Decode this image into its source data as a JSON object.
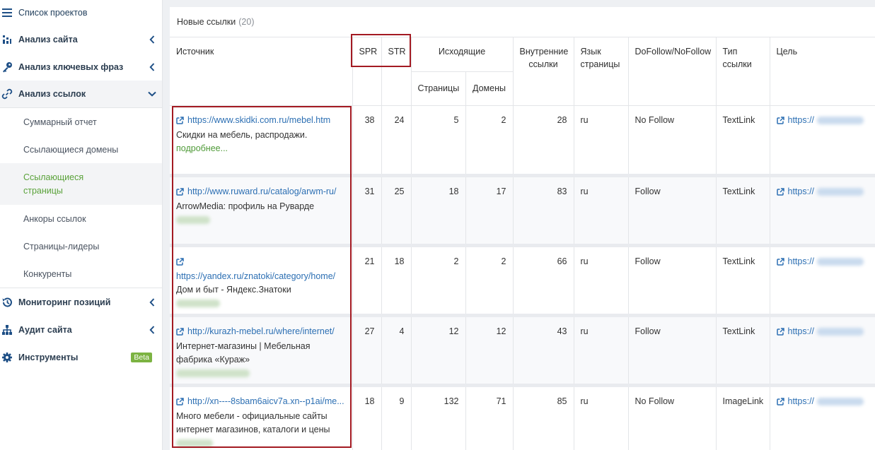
{
  "sidebar": {
    "top": {
      "label": "Список проектов",
      "icon": "menu-icon"
    },
    "items": [
      {
        "label": "Анализ сайта",
        "icon": "site-analysis-icon"
      },
      {
        "label": "Анализ ключевых фраз",
        "icon": "key-icon"
      },
      {
        "label": "Анализ ссылок",
        "icon": "link-icon"
      },
      {
        "label": "Мониторинг позиций",
        "icon": "history-icon"
      },
      {
        "label": "Аудит сайта",
        "icon": "sitemap-icon"
      },
      {
        "label": "Инструменты",
        "icon": "gear-icon",
        "badge": "Beta"
      }
    ],
    "subitems": [
      "Суммарный отчет",
      "Ссылающиеся домены",
      "Ссылающиеся страницы",
      "Анкоры ссылок",
      "Страницы-лидеры",
      "Конкуренты"
    ]
  },
  "panel": {
    "title": "Новые ссылки",
    "count": "(20)"
  },
  "table": {
    "headers": {
      "source": "Источник",
      "spr": "SPR",
      "str": "STR",
      "outgoing": "Исходящие",
      "pages": "Страницы",
      "domains": "Домены",
      "internal": "Внутренние ссылки",
      "lang": "Язык страницы",
      "follow": "DoFollow/NoFollow",
      "type": "Тип ссылки",
      "target": "Цель"
    },
    "rows": [
      {
        "url": "https://www.skidki.com.ru/mebel.htm",
        "title": "Скидки на мебель, распродажи.",
        "more": "подробнее...",
        "spr": "38",
        "str": "24",
        "pages": "5",
        "domains": "2",
        "internal": "28",
        "lang": "ru",
        "follow": "No Follow",
        "type": "TextLink",
        "target": "https://"
      },
      {
        "url": "http://www.ruward.ru/catalog/arwm-ru/",
        "title": "ArrowMedia: профиль на Руварде",
        "spr": "31",
        "str": "25",
        "pages": "18",
        "domains": "17",
        "internal": "83",
        "lang": "ru",
        "follow": "Follow",
        "type": "TextLink",
        "target": "https://"
      },
      {
        "url": "https://yandex.ru/znatoki/category/home/",
        "title": "Дом и быт - Яндекс.Знатоки",
        "spr": "21",
        "str": "18",
        "pages": "2",
        "domains": "2",
        "internal": "66",
        "lang": "ru",
        "follow": "Follow",
        "type": "TextLink",
        "target": "https://"
      },
      {
        "url": "http://kurazh-mebel.ru/where/internet/",
        "title": "Интернет-магазины | Мебельная фабрика «Кураж»",
        "spr": "27",
        "str": "4",
        "pages": "12",
        "domains": "12",
        "internal": "43",
        "lang": "ru",
        "follow": "Follow",
        "type": "TextLink",
        "target": "https://"
      },
      {
        "url": "http://xn----8sbam6aicv7a.xn--p1ai/me...",
        "title": "Много мебели - официальные сайты интернет магазинов, каталоги и цены",
        "spr": "18",
        "str": "9",
        "pages": "132",
        "domains": "71",
        "internal": "85",
        "lang": "ru",
        "follow": "No Follow",
        "type": "ImageLink",
        "target": "https://"
      }
    ]
  }
}
